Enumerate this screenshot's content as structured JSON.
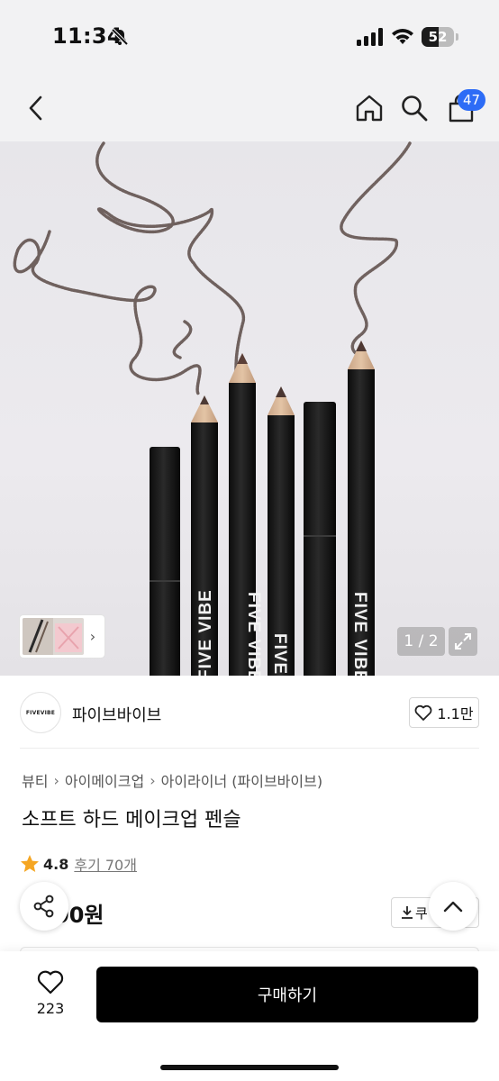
{
  "status_bar": {
    "time": "11:34",
    "battery": "52",
    "battery_level": 0.52
  },
  "header": {
    "cart_count": "47",
    "icons": [
      "back-icon",
      "home-icon",
      "search-icon",
      "cart-icon"
    ]
  },
  "gallery": {
    "page_indicator": "1 / 2",
    "pencil_brand_text": "FIVE VIBE"
  },
  "brand": {
    "logo_text": "FIVEVIBE",
    "name": "파이브바이브",
    "likes": "1.1만"
  },
  "breadcrumb": [
    "뷰티",
    "아이메이크업",
    "아이라이너 (파이브바이브)"
  ],
  "product": {
    "title": "소프트 하드 메이크업 펜슬",
    "rating": "4.8",
    "reviews": "후기 70개",
    "price": "00원",
    "coupon_label": "쿠"
  },
  "bottom": {
    "wish_count": "223",
    "buy_label": "구매하기"
  },
  "colors": {
    "accent_badge": "#2d6cf6",
    "star": "#f5a623",
    "buy_button": "#000000"
  }
}
